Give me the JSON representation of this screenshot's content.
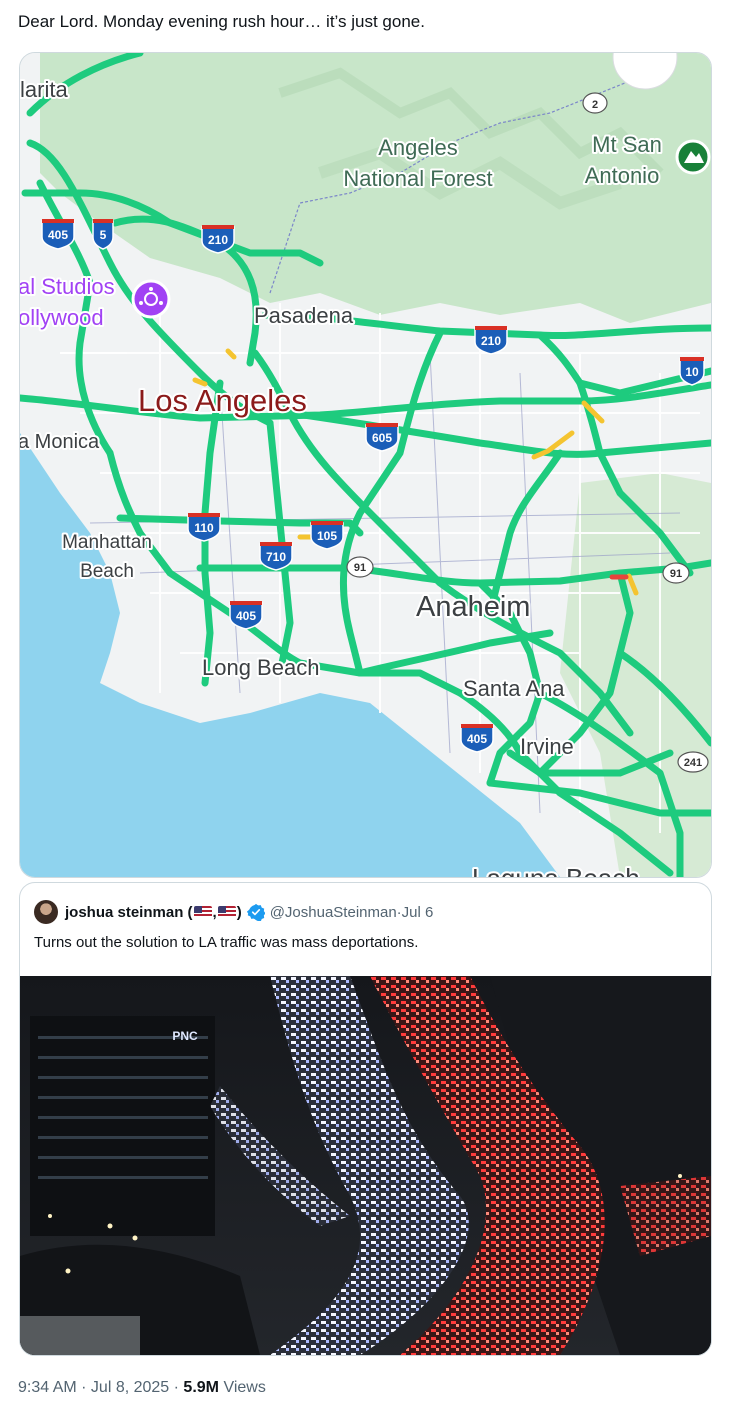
{
  "tweet": {
    "text": "Dear Lord. Monday evening rush hour… it’s just gone."
  },
  "map": {
    "region_labels": {
      "santa_clarita": "larita",
      "angeles_forest_line1": "Angeles",
      "angeles_forest_line2": "National Forest",
      "mt_san_antonio_line1": "Mt San",
      "mt_san_antonio_line2": "Antonio",
      "universal_line1": "al Studios",
      "universal_line2": "ollywood",
      "pasadena": "Pasadena",
      "los_angeles": "Los Angeles",
      "santa_monica": "a Monica",
      "manhattan_line1": "Manhattan",
      "manhattan_line2": "Beach",
      "anaheim": "Anaheim",
      "long_beach": "Long Beach",
      "santa_ana": "Santa Ana",
      "irvine": "Irvine",
      "laguna": "Laguna Beach"
    },
    "shields": {
      "i405_north": "405",
      "i5": "5",
      "i210_west": "210",
      "i210_east": "210",
      "i10": "10",
      "i605": "605",
      "i110": "110",
      "i105": "105",
      "i710": "710",
      "i405_south": "405",
      "i405_irvine": "405",
      "sr2": "2",
      "sr91_west": "91",
      "sr91_east": "91",
      "sr241": "241"
    },
    "colors": {
      "freeway_clear": "#1ecb7e",
      "freeway_slow": "#f4c430",
      "freeway_stop": "#e8453c",
      "water": "#8fd3ee",
      "forest": "#c8e6c9",
      "land": "#f1f3f4",
      "poi_purple": "#a142f4"
    }
  },
  "quote": {
    "author_name": "joshua steinman (",
    "author_name_sep": ",",
    "author_name_end": ")",
    "handle": "@JoshuaSteinman",
    "date_sep": " · ",
    "date": "Jul 6",
    "text": "Turns out the solution to LA traffic was mass deportations.",
    "photo": {
      "building_sign": "PNC"
    }
  },
  "footer": {
    "time": "9:34 AM",
    "sep1": " · ",
    "date": "Jul 8, 2025",
    "sep2": " · ",
    "views_count": "5.9M",
    "views_label": "Views"
  }
}
